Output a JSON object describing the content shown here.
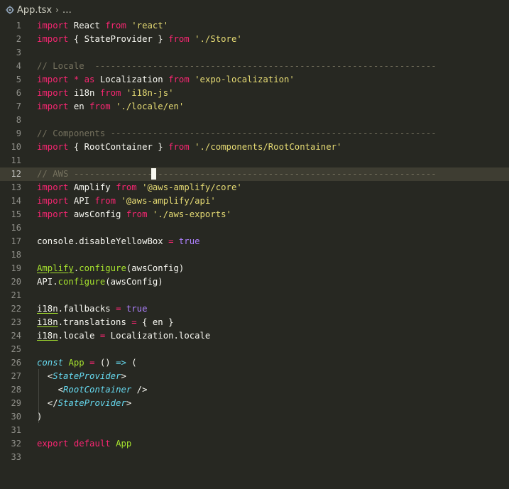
{
  "breadcrumb": {
    "file": "App.tsx",
    "separator": "›",
    "more": "…"
  },
  "lines": [
    {
      "n": "1",
      "t": [
        {
          "c": "kw",
          "s": "import"
        },
        {
          "c": "",
          "s": " React "
        },
        {
          "c": "kw",
          "s": "from"
        },
        {
          "c": "",
          "s": " "
        },
        {
          "c": "str",
          "s": "'react'"
        }
      ]
    },
    {
      "n": "2",
      "t": [
        {
          "c": "kw",
          "s": "import"
        },
        {
          "c": "",
          "s": " { StateProvider } "
        },
        {
          "c": "kw",
          "s": "from"
        },
        {
          "c": "",
          "s": " "
        },
        {
          "c": "str",
          "s": "'./Store'"
        }
      ]
    },
    {
      "n": "3",
      "t": []
    },
    {
      "n": "4",
      "t": [
        {
          "c": "cm",
          "s": "// Locale  -----------------------------------------------------------------"
        }
      ]
    },
    {
      "n": "5",
      "t": [
        {
          "c": "kw",
          "s": "import"
        },
        {
          "c": "",
          "s": " "
        },
        {
          "c": "op",
          "s": "*"
        },
        {
          "c": "",
          "s": " "
        },
        {
          "c": "kw",
          "s": "as"
        },
        {
          "c": "",
          "s": " Localization "
        },
        {
          "c": "kw",
          "s": "from"
        },
        {
          "c": "",
          "s": " "
        },
        {
          "c": "str",
          "s": "'expo-localization'"
        }
      ]
    },
    {
      "n": "6",
      "t": [
        {
          "c": "kw",
          "s": "import"
        },
        {
          "c": "",
          "s": " i18n "
        },
        {
          "c": "kw",
          "s": "from"
        },
        {
          "c": "",
          "s": " "
        },
        {
          "c": "str",
          "s": "'i18n-js'"
        }
      ]
    },
    {
      "n": "7",
      "t": [
        {
          "c": "kw",
          "s": "import"
        },
        {
          "c": "",
          "s": " en "
        },
        {
          "c": "kw",
          "s": "from"
        },
        {
          "c": "",
          "s": " "
        },
        {
          "c": "str",
          "s": "'./locale/en'"
        }
      ]
    },
    {
      "n": "8",
      "t": []
    },
    {
      "n": "9",
      "t": [
        {
          "c": "cm",
          "s": "// Components --------------------------------------------------------------"
        }
      ]
    },
    {
      "n": "10",
      "t": [
        {
          "c": "kw",
          "s": "import"
        },
        {
          "c": "",
          "s": " { RootContainer } "
        },
        {
          "c": "kw",
          "s": "from"
        },
        {
          "c": "",
          "s": " "
        },
        {
          "c": "str",
          "s": "'./components/RootContainer'"
        }
      ]
    },
    {
      "n": "11",
      "t": []
    },
    {
      "n": "12",
      "t": [
        {
          "c": "cm",
          "s": "// AWS ---------------------------------------------------------------------"
        }
      ]
    },
    {
      "n": "13",
      "t": [
        {
          "c": "kw",
          "s": "import"
        },
        {
          "c": "",
          "s": " Amplify "
        },
        {
          "c": "kw",
          "s": "from"
        },
        {
          "c": "",
          "s": " "
        },
        {
          "c": "str",
          "s": "'@aws-amplify/core'"
        }
      ]
    },
    {
      "n": "14",
      "t": [
        {
          "c": "kw",
          "s": "import"
        },
        {
          "c": "",
          "s": " API "
        },
        {
          "c": "kw",
          "s": "from"
        },
        {
          "c": "",
          "s": " "
        },
        {
          "c": "str",
          "s": "'@aws-amplify/api'"
        }
      ]
    },
    {
      "n": "15",
      "t": [
        {
          "c": "kw",
          "s": "import"
        },
        {
          "c": "",
          "s": " awsConfig "
        },
        {
          "c": "kw",
          "s": "from"
        },
        {
          "c": "",
          "s": " "
        },
        {
          "c": "str",
          "s": "'./aws-exports'"
        }
      ]
    },
    {
      "n": "16",
      "t": []
    },
    {
      "n": "17",
      "t": [
        {
          "c": "",
          "s": "console.disableYellowBox "
        },
        {
          "c": "op",
          "s": "="
        },
        {
          "c": "",
          "s": " "
        },
        {
          "c": "cst",
          "s": "true"
        }
      ]
    },
    {
      "n": "18",
      "t": []
    },
    {
      "n": "19",
      "t": [
        {
          "c": "fn ul",
          "s": "Amplify"
        },
        {
          "c": "",
          "s": "."
        },
        {
          "c": "fn",
          "s": "configure"
        },
        {
          "c": "",
          "s": "(awsConfig)"
        }
      ]
    },
    {
      "n": "20",
      "t": [
        {
          "c": "",
          "s": "API."
        },
        {
          "c": "fn",
          "s": "configure"
        },
        {
          "c": "",
          "s": "(awsConfig)"
        }
      ]
    },
    {
      "n": "21",
      "t": []
    },
    {
      "n": "22",
      "t": [
        {
          "c": "ul",
          "s": "i18n"
        },
        {
          "c": "",
          "s": ".fallbacks "
        },
        {
          "c": "op",
          "s": "="
        },
        {
          "c": "",
          "s": " "
        },
        {
          "c": "cst",
          "s": "true"
        }
      ]
    },
    {
      "n": "23",
      "t": [
        {
          "c": "ul",
          "s": "i18n"
        },
        {
          "c": "",
          "s": ".translations "
        },
        {
          "c": "op",
          "s": "="
        },
        {
          "c": "",
          "s": " { en }"
        }
      ]
    },
    {
      "n": "24",
      "t": [
        {
          "c": "ul",
          "s": "i18n"
        },
        {
          "c": "",
          "s": ".locale "
        },
        {
          "c": "op",
          "s": "="
        },
        {
          "c": "",
          "s": " Localization.locale"
        }
      ]
    },
    {
      "n": "25",
      "t": []
    },
    {
      "n": "26",
      "t": [
        {
          "c": "sto",
          "s": "const"
        },
        {
          "c": "",
          "s": " "
        },
        {
          "c": "fn",
          "s": "App"
        },
        {
          "c": "",
          "s": " "
        },
        {
          "c": "op",
          "s": "="
        },
        {
          "c": "",
          "s": " () "
        },
        {
          "c": "arrow",
          "s": "=>"
        },
        {
          "c": "",
          "s": " ("
        }
      ]
    },
    {
      "n": "27",
      "t": [
        {
          "c": "",
          "s": "  <"
        },
        {
          "c": "tag",
          "s": "StateProvider"
        },
        {
          "c": "",
          "s": ">"
        }
      ]
    },
    {
      "n": "28",
      "t": [
        {
          "c": "",
          "s": "    <"
        },
        {
          "c": "tag",
          "s": "RootContainer"
        },
        {
          "c": "",
          "s": " />"
        }
      ]
    },
    {
      "n": "29",
      "t": [
        {
          "c": "",
          "s": "  </"
        },
        {
          "c": "tag",
          "s": "StateProvider"
        },
        {
          "c": "",
          "s": ">"
        }
      ]
    },
    {
      "n": "30",
      "t": [
        {
          "c": "",
          "s": ")"
        }
      ]
    },
    {
      "n": "31",
      "t": []
    },
    {
      "n": "32",
      "t": [
        {
          "c": "kw",
          "s": "export"
        },
        {
          "c": "",
          "s": " "
        },
        {
          "c": "kw",
          "s": "default"
        },
        {
          "c": "",
          "s": " "
        },
        {
          "c": "fn",
          "s": "App"
        }
      ]
    },
    {
      "n": "33",
      "t": []
    }
  ],
  "current_line": "12",
  "colors": {
    "background": "#272822",
    "keyword": "#f92672",
    "string": "#e6db74",
    "comment": "#75715e",
    "function": "#a6e22e",
    "constant": "#ae81ff",
    "type": "#66d9ef"
  }
}
